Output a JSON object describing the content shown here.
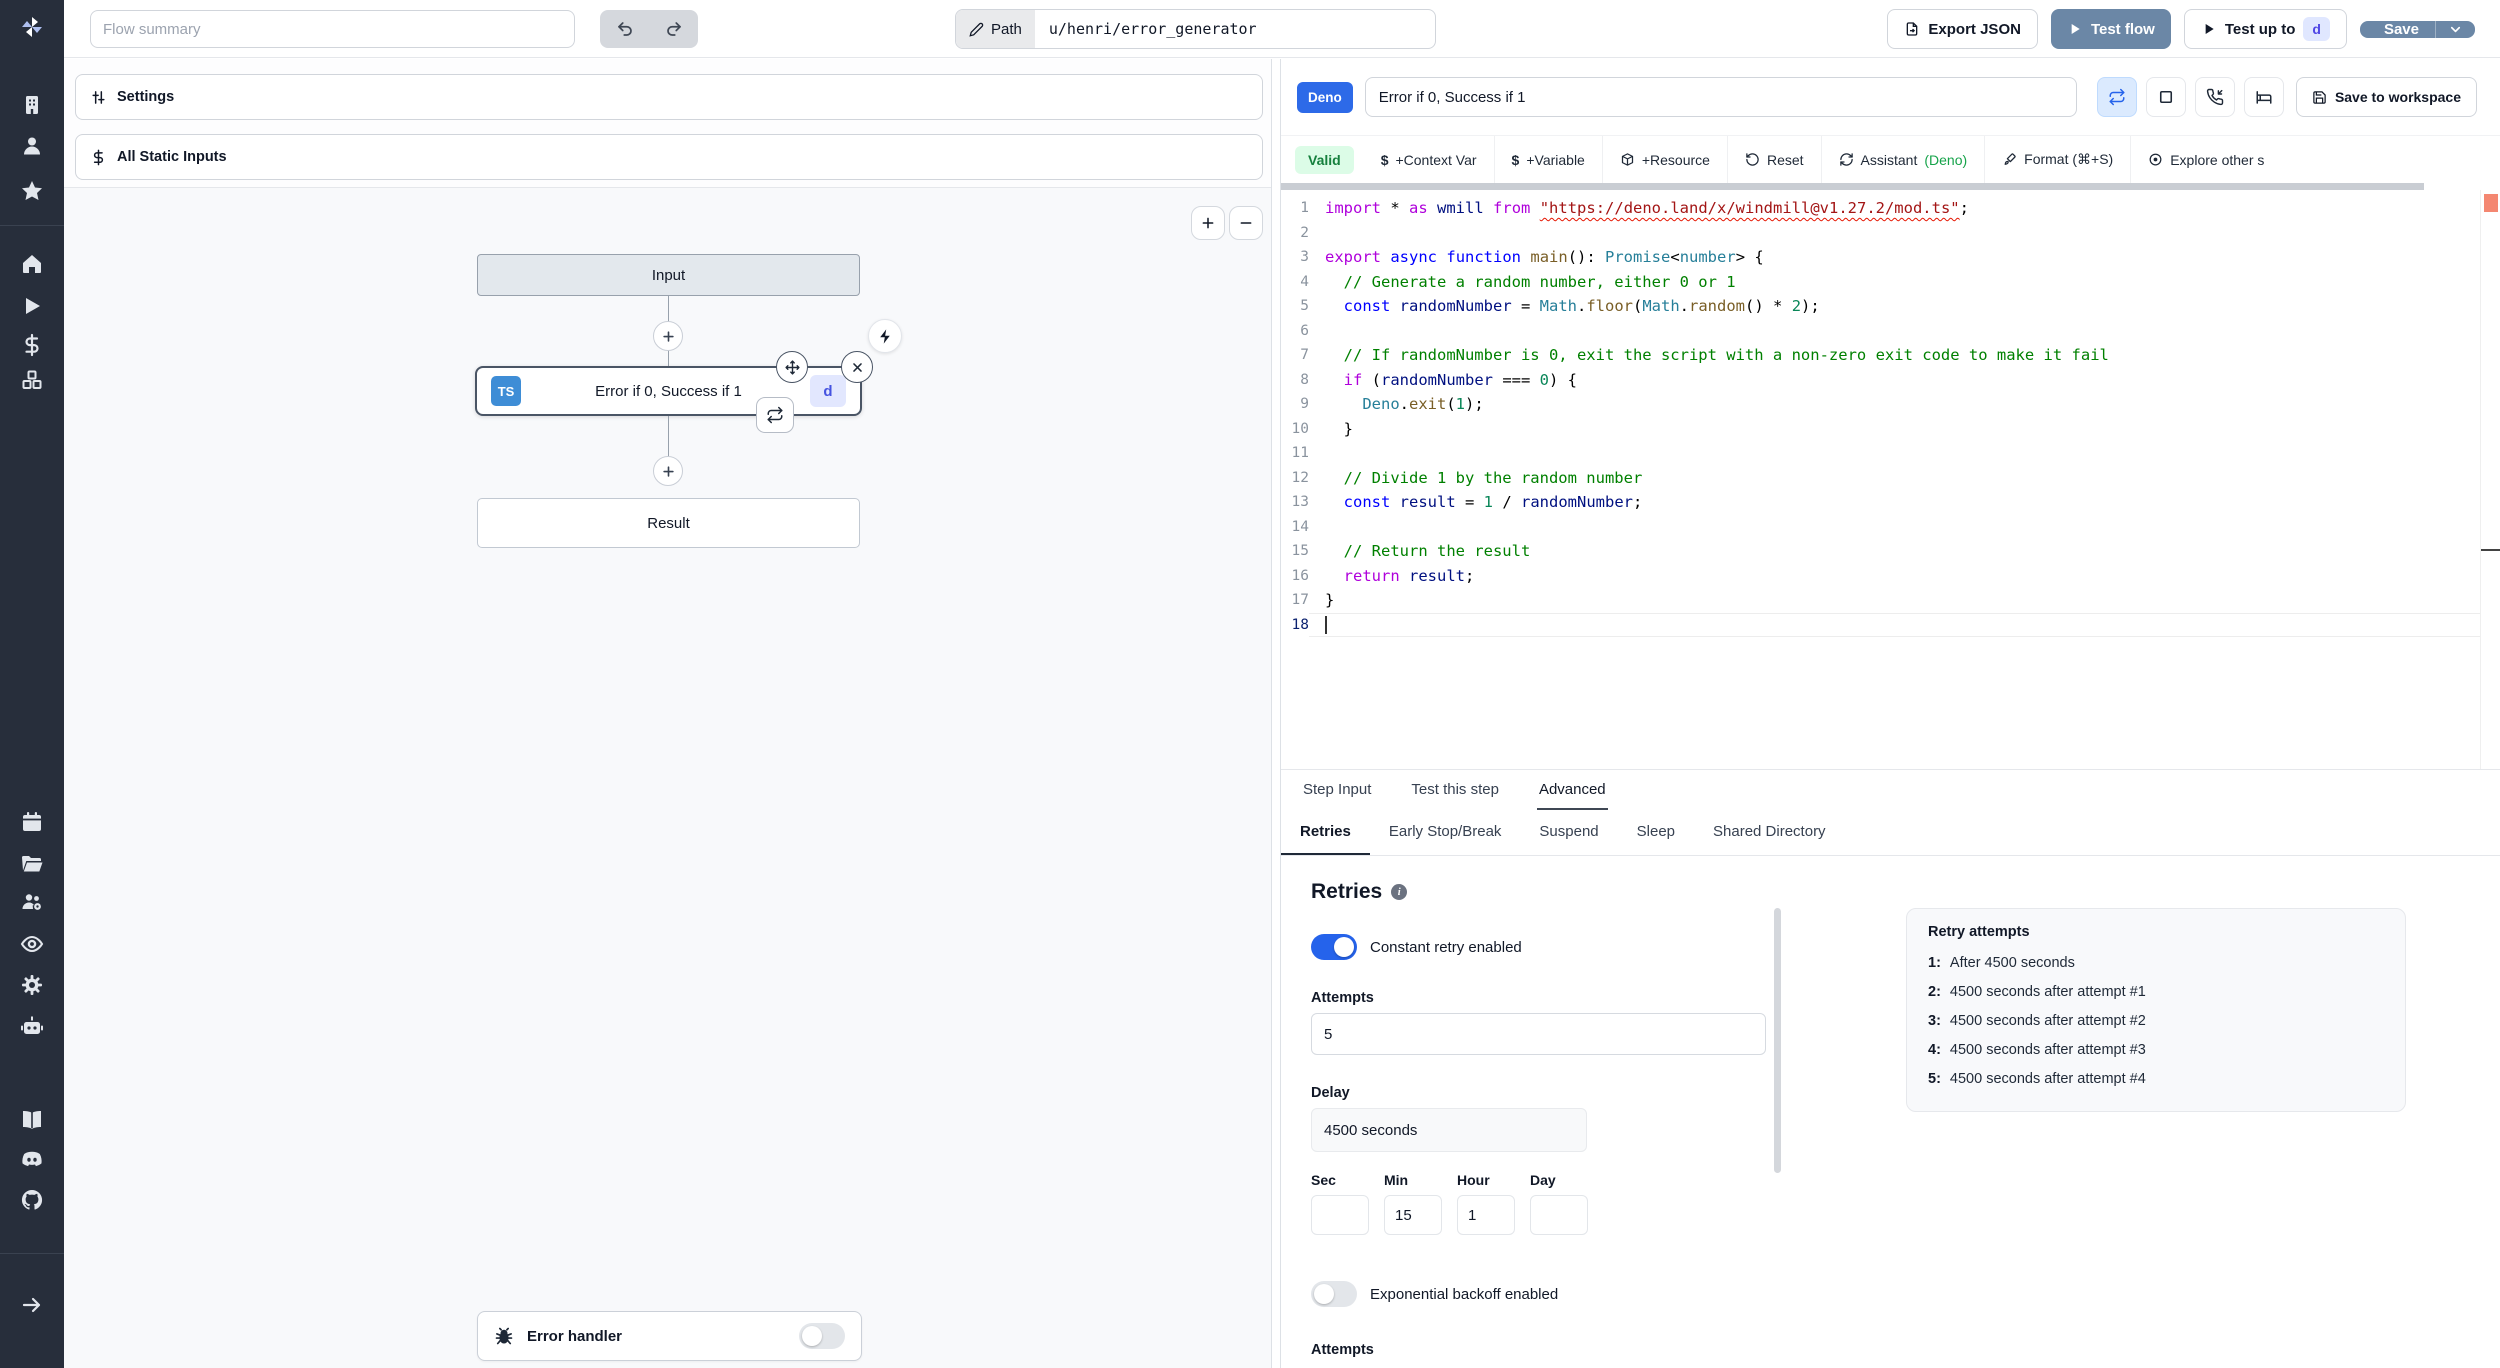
{
  "colors": {
    "sidebar_bg": "#272E3B",
    "accent_blue": "#2D6AE8",
    "steel_button": "#6B87A6",
    "toggle_on": "#2563EB",
    "valid_bg": "#DCFCE7",
    "valid_text": "#15803D",
    "ts_badge": "#3E8DD6",
    "d_badge_bg": "#E0E7FF",
    "d_badge_text": "#4F46E5",
    "error_marker": "#F48771"
  },
  "topbar": {
    "flow_summary_placeholder": "Flow summary",
    "path_label": "Path",
    "path_value": "u/henri/error_generator",
    "export_json": "Export JSON",
    "test_flow": "Test flow",
    "test_up_to": "Test up to",
    "test_up_to_badge": "d",
    "save": "Save"
  },
  "sidebar": {
    "icons": [
      "windmill-logo",
      "building",
      "user",
      "star",
      "home",
      "play",
      "dollar",
      "boxes",
      "calendar",
      "folder-open",
      "user-group-gear",
      "eye",
      "gear",
      "robot",
      "book-open",
      "discord",
      "github",
      "arrow-right"
    ]
  },
  "canvas": {
    "settings_label": "Settings",
    "static_inputs_label": "All Static Inputs",
    "zoom_in": "+",
    "zoom_out": "−",
    "nodes": {
      "input": "Input",
      "step": {
        "lang_badge": "TS",
        "title": "Error if 0, Success if 1",
        "suffix_badge": "d"
      },
      "result": "Result"
    },
    "error_handler_label": "Error handler"
  },
  "step_editor": {
    "lang_badge": "Deno",
    "step_name": "Error if 0, Success if 1",
    "save_to_workspace": "Save to workspace",
    "toolbar": {
      "valid": "Valid",
      "context_var": "+Context Var",
      "variable": "+Variable",
      "resource": "+Resource",
      "reset": "Reset",
      "assistant": "Assistant",
      "assistant_lang": "(Deno)",
      "format": "Format (⌘+S)",
      "explore": "Explore other s"
    },
    "code": {
      "lines": [
        {
          "n": "1",
          "t": [
            [
              "k2",
              "import"
            ],
            [
              "p",
              " * "
            ],
            [
              "k2",
              "as"
            ],
            [
              "p",
              " "
            ],
            [
              "v",
              "wmill"
            ],
            [
              "p",
              " "
            ],
            [
              "k2",
              "from"
            ],
            [
              "p",
              " "
            ],
            [
              "se",
              "\"https://deno.land/x/windmill@v1.27.2/mod.ts\""
            ],
            [
              "p",
              ";"
            ]
          ]
        },
        {
          "n": "2",
          "t": []
        },
        {
          "n": "3",
          "t": [
            [
              "k2",
              "export"
            ],
            [
              "p",
              " "
            ],
            [
              "k",
              "async"
            ],
            [
              "p",
              " "
            ],
            [
              "k",
              "function"
            ],
            [
              "p",
              " "
            ],
            [
              "f",
              "main"
            ],
            [
              "p",
              "(): "
            ],
            [
              "t",
              "Promise"
            ],
            [
              "p",
              "<"
            ],
            [
              "t",
              "number"
            ],
            [
              "p",
              "> {"
            ]
          ]
        },
        {
          "n": "4",
          "t": [
            [
              "c",
              "  // Generate a random number, either 0 or 1"
            ]
          ]
        },
        {
          "n": "5",
          "t": [
            [
              "k",
              "  const"
            ],
            [
              "p",
              " "
            ],
            [
              "v",
              "randomNumber"
            ],
            [
              "p",
              " = "
            ],
            [
              "t",
              "Math"
            ],
            [
              "p",
              "."
            ],
            [
              "f",
              "floor"
            ],
            [
              "p",
              "("
            ],
            [
              "t",
              "Math"
            ],
            [
              "p",
              "."
            ],
            [
              "f",
              "random"
            ],
            [
              "p",
              "() * "
            ],
            [
              "n2",
              "2"
            ],
            [
              "p",
              ");"
            ]
          ]
        },
        {
          "n": "6",
          "t": []
        },
        {
          "n": "7",
          "t": [
            [
              "c",
              "  // If randomNumber is 0, exit the script with a non-zero exit code to make it fail"
            ]
          ]
        },
        {
          "n": "8",
          "t": [
            [
              "k2",
              "  if"
            ],
            [
              "p",
              " ("
            ],
            [
              "v",
              "randomNumber"
            ],
            [
              "p",
              " === "
            ],
            [
              "n2",
              "0"
            ],
            [
              "p",
              ") {"
            ]
          ]
        },
        {
          "n": "9",
          "t": [
            [
              "t",
              "    Deno"
            ],
            [
              "p",
              "."
            ],
            [
              "f",
              "exit"
            ],
            [
              "p",
              "("
            ],
            [
              "n2",
              "1"
            ],
            [
              "p",
              ");"
            ]
          ]
        },
        {
          "n": "10",
          "t": [
            [
              "p",
              "  }"
            ]
          ]
        },
        {
          "n": "11",
          "t": []
        },
        {
          "n": "12",
          "t": [
            [
              "c",
              "  // Divide 1 by the random number"
            ]
          ]
        },
        {
          "n": "13",
          "t": [
            [
              "k",
              "  const"
            ],
            [
              "p",
              " "
            ],
            [
              "v",
              "result"
            ],
            [
              "p",
              " = "
            ],
            [
              "n2",
              "1"
            ],
            [
              "p",
              " / "
            ],
            [
              "v",
              "randomNumber"
            ],
            [
              "p",
              ";"
            ]
          ]
        },
        {
          "n": "14",
          "t": []
        },
        {
          "n": "15",
          "t": [
            [
              "c",
              "  // Return the result"
            ]
          ]
        },
        {
          "n": "16",
          "t": [
            [
              "k2",
              "  return"
            ],
            [
              "p",
              " "
            ],
            [
              "v",
              "result"
            ],
            [
              "p",
              ";"
            ]
          ]
        },
        {
          "n": "17",
          "t": [
            [
              "p",
              "}"
            ]
          ]
        },
        {
          "n": "18",
          "t": [],
          "active": true
        }
      ]
    }
  },
  "panel_tabs": {
    "main": [
      "Step Input",
      "Test this step",
      "Advanced"
    ],
    "active_main": "Advanced",
    "sub": [
      "Retries",
      "Early Stop/Break",
      "Suspend",
      "Sleep",
      "Shared Directory"
    ],
    "active_sub": "Retries"
  },
  "retries": {
    "title": "Retries",
    "constant_toggle_label": "Constant retry enabled",
    "constant_enabled": true,
    "attempts_label": "Attempts",
    "attempts_value": "5",
    "delay_label": "Delay",
    "delay_value": "4500 seconds",
    "time_fields": [
      {
        "label": "Sec",
        "value": ""
      },
      {
        "label": "Min",
        "value": "15"
      },
      {
        "label": "Hour",
        "value": "1"
      },
      {
        "label": "Day",
        "value": ""
      }
    ],
    "exponential_toggle_label": "Exponential backoff enabled",
    "exponential_enabled": false,
    "cutoff_label": "Attempts",
    "summary": {
      "title": "Retry attempts",
      "items": [
        {
          "n": "1:",
          "text": "After 4500 seconds"
        },
        {
          "n": "2:",
          "text": "4500 seconds after attempt #1"
        },
        {
          "n": "3:",
          "text": "4500 seconds after attempt #2"
        },
        {
          "n": "4:",
          "text": "4500 seconds after attempt #3"
        },
        {
          "n": "5:",
          "text": "4500 seconds after attempt #4"
        }
      ]
    }
  }
}
